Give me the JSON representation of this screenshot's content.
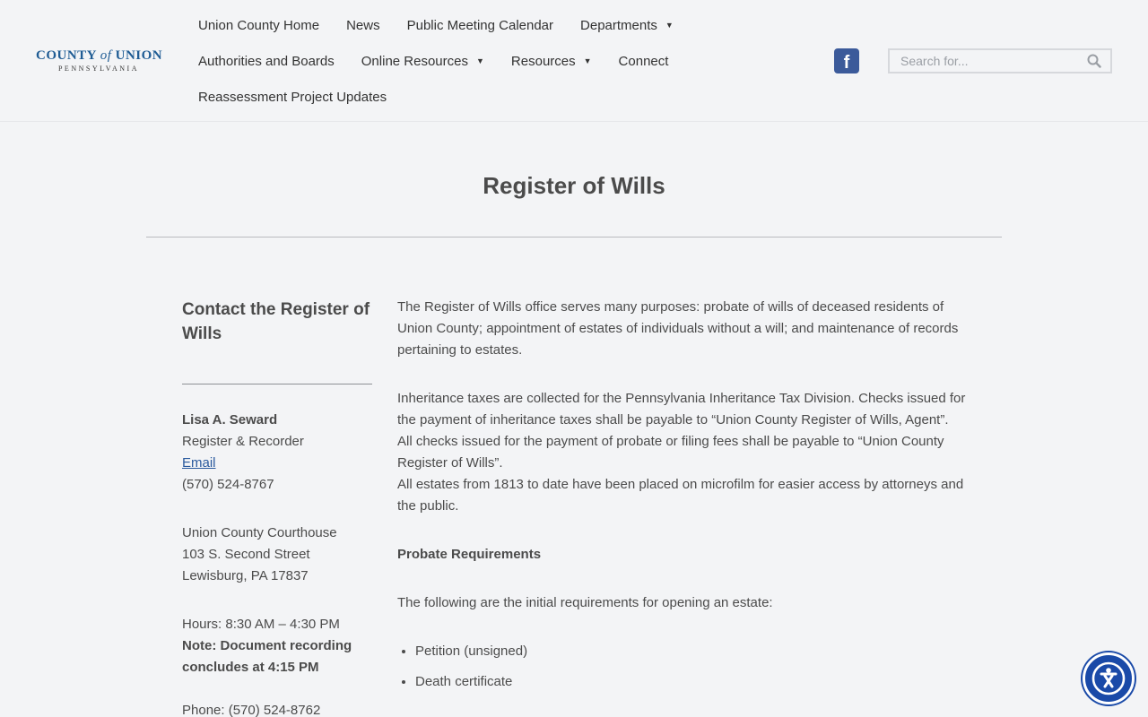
{
  "logo": {
    "county": "COUNTY",
    "of": "of",
    "union": "UNION",
    "state": "PENNSYLVANIA"
  },
  "nav": {
    "row1": [
      "Union County Home",
      "News",
      "Public Meeting Calendar",
      "Departments"
    ],
    "row2": [
      "Authorities and Boards",
      "Online Resources",
      "Resources",
      "Connect"
    ],
    "row3": [
      "Reassessment Project Updates"
    ]
  },
  "social": {
    "facebook_glyph": "f",
    "icon": "facebook-icon",
    "color": "#3b5a9a"
  },
  "search": {
    "placeholder": "Search for..."
  },
  "page": {
    "title": "Register of Wills"
  },
  "sidebar": {
    "heading": "Contact the Register of Wills",
    "name": "Lisa A. Seward",
    "role": "Register & Recorder",
    "email_label": "Email",
    "phone1": "(570) 524-8767",
    "address": [
      "Union County Courthouse",
      "103 S. Second Street",
      "Lewisburg, PA 17837"
    ],
    "hours": "Hours: 8:30 AM – 4:30 PM",
    "note": "Note: Document recording concludes at 4:15 PM",
    "phone2": "Phone: (570) 524-8762"
  },
  "main": {
    "intro": "The Register of Wills office serves many purposes: probate of wills of deceased residents of Union County; appointment of estates of individuals without a will; and maintenance of records pertaining to estates.",
    "tax1": "Inheritance taxes are collected for the Pennsylvania Inheritance Tax Division. Checks issued for the payment of inheritance taxes shall be payable to “Union County Register of Wills, Agent”.",
    "tax2": "All checks issued for the payment of probate or filing fees shall be payable to “Union County Register of Wills”.",
    "tax3": "All estates from 1813 to date have been placed on microfilm for easier access by attorneys and the public.",
    "probate_heading": "Probate Requirements",
    "probate_intro": "The following are the initial requirements for opening an estate:",
    "requirements": [
      "Petition (unsigned)",
      "Death certificate"
    ]
  },
  "colors": {
    "accent": "#2a5a9e",
    "accessibility": "#1a4aa8"
  }
}
